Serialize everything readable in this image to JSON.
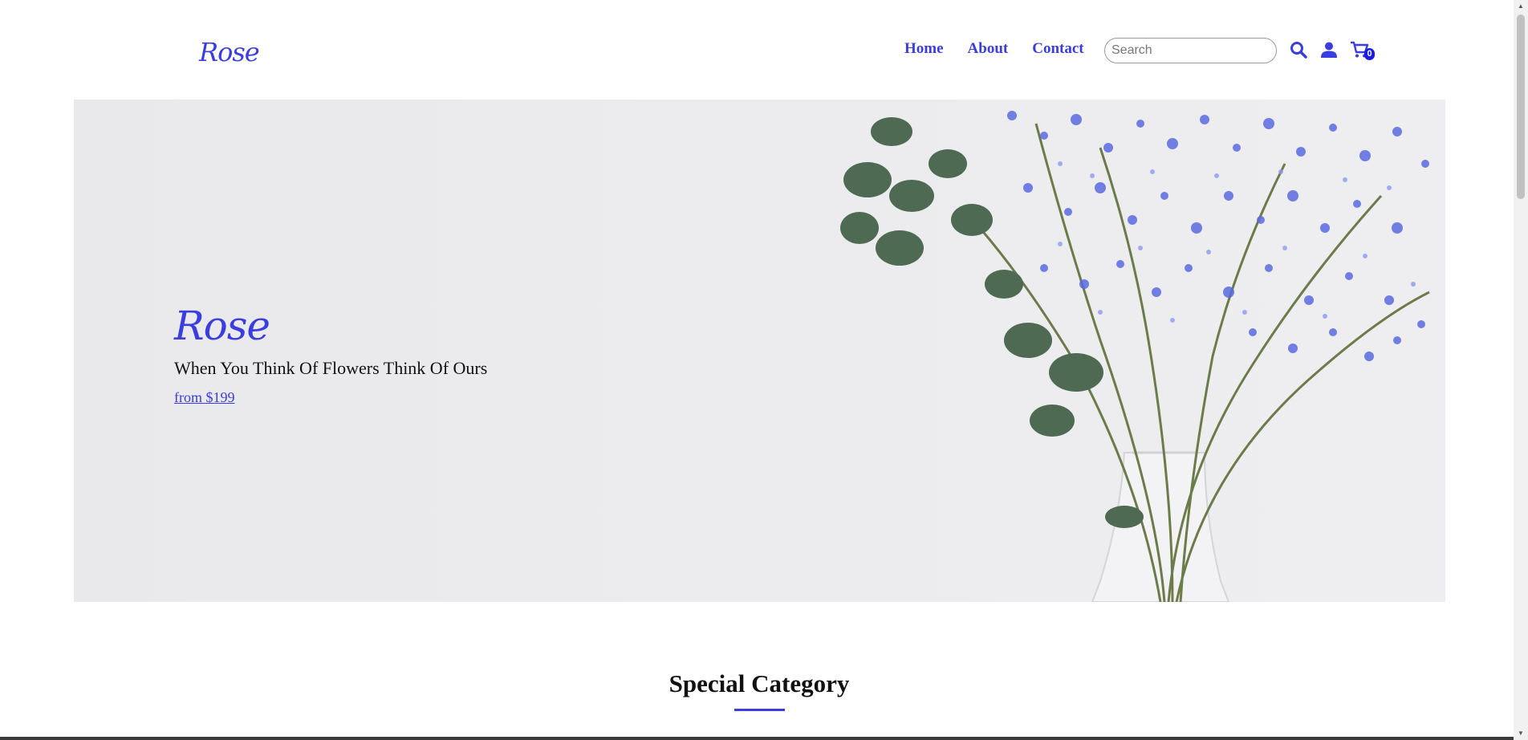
{
  "brand": {
    "logo_text": "Rose"
  },
  "nav": {
    "items": [
      {
        "label": "Home"
      },
      {
        "label": "About"
      },
      {
        "label": "Contact"
      }
    ]
  },
  "search": {
    "placeholder": "Search",
    "value": ""
  },
  "header_icons": {
    "search_icon": "search-icon",
    "account_icon": "user-icon",
    "cart_icon": "cart-icon",
    "cart_count": "0"
  },
  "hero": {
    "title": "Rose",
    "subtitle": "When You Think Of Flowers Think Of Ours",
    "price_link": "from $199"
  },
  "section": {
    "title": "Special Category"
  },
  "colors": {
    "accent": "#3a3de0",
    "badge": "#1a1ae8",
    "hero_bg": "#ececee"
  }
}
